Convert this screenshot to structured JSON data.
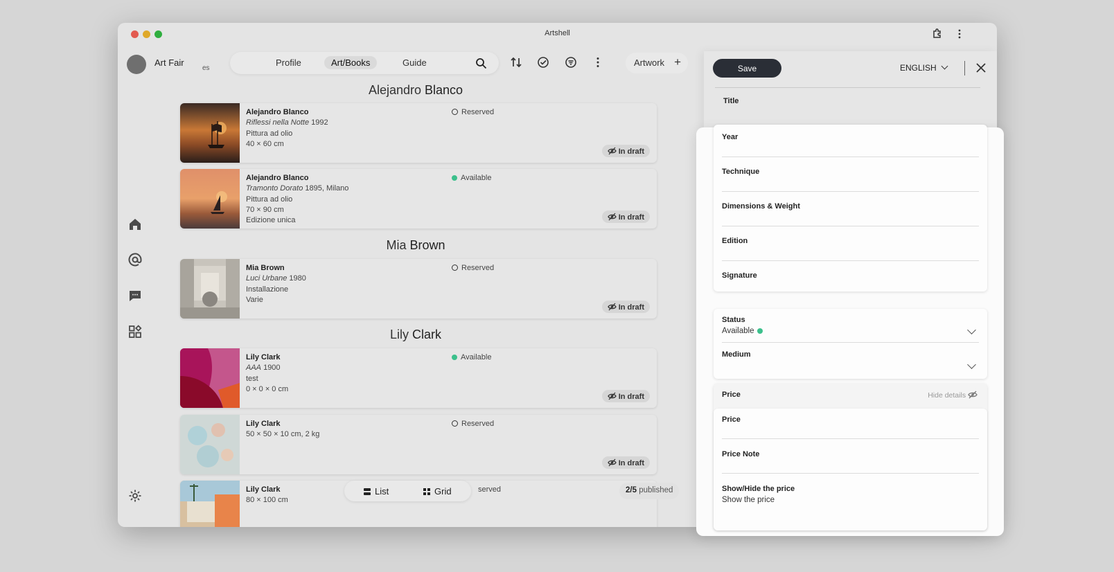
{
  "window": {
    "title": "Artshell"
  },
  "account": {
    "name": "Art Fair",
    "sub": "es"
  },
  "nav": {
    "tabs": [
      "Profile",
      "Art/Books",
      "Guide"
    ],
    "active": "Art/Books"
  },
  "toolbar": {
    "artwork_label": "Artwork"
  },
  "groups": [
    {
      "first": "Alejandro",
      "last": "Blanco"
    },
    {
      "first": "Mia",
      "last": "Brown"
    },
    {
      "first": "Lily",
      "last": "Clark"
    }
  ],
  "cards": [
    {
      "artist": "Alejandro Blanco",
      "title": "Riflessi nella Notte",
      "title_suffix": " 1992",
      "line2": "Pittura ad olio",
      "line3": "40 × 60 cm",
      "line4": "",
      "status": "Reserved",
      "status_type": "reserved",
      "draft": "In draft"
    },
    {
      "artist": "Alejandro Blanco",
      "title": "Tramonto Dorato",
      "title_suffix": " 1895, Milano",
      "line2": "Pittura ad olio",
      "line3": "70 × 90 cm",
      "line4": "Edizione unica",
      "status": "Available",
      "status_type": "available",
      "draft": "In draft"
    },
    {
      "artist": "Mia Brown",
      "title": "Luci Urbane",
      "title_suffix": " 1980",
      "line2": "Installazione",
      "line3": "Varie",
      "line4": "",
      "status": "Reserved",
      "status_type": "reserved",
      "draft": "In draft"
    },
    {
      "artist": "Lily Clark",
      "title": "AAA",
      "title_suffix": " 1900",
      "line2": "test",
      "line3": "0 × 0 × 0 cm",
      "line4": "",
      "status": "Available",
      "status_type": "available",
      "draft": "In draft"
    },
    {
      "artist": "Lily Clark",
      "title": "",
      "title_suffix": "",
      "line2": "50 × 50 × 10 cm, 2 kg",
      "line3": "",
      "line4": "",
      "status": "Reserved",
      "status_type": "reserved",
      "draft": "In draft"
    },
    {
      "artist": "Lily Clark",
      "title": "",
      "title_suffix": "",
      "line2": "80 × 100 cm",
      "line3": "",
      "line4": "",
      "status": "served",
      "status_type": "partial",
      "draft": ""
    }
  ],
  "view_toggle": {
    "list": "List",
    "grid": "Grid"
  },
  "published": {
    "count": "2/5",
    "label": " published"
  },
  "panel": {
    "save": "Save",
    "language": "ENGLISH",
    "title_label": "Title",
    "fields": [
      "Year",
      "Technique",
      "Dimensions & Weight",
      "Edition",
      "Signature"
    ],
    "status_label": "Status",
    "status_value": "Available",
    "medium_label": "Medium",
    "price_section": "Price",
    "hide_details": "Hide details",
    "price_label": "Price",
    "price_note_label": "Price Note",
    "show_hide_label": "Show/Hide the price",
    "show_hide_value": "Show the price"
  },
  "colors": {
    "accent_available": "#3cc08c",
    "save_bg": "#2a2e36"
  }
}
